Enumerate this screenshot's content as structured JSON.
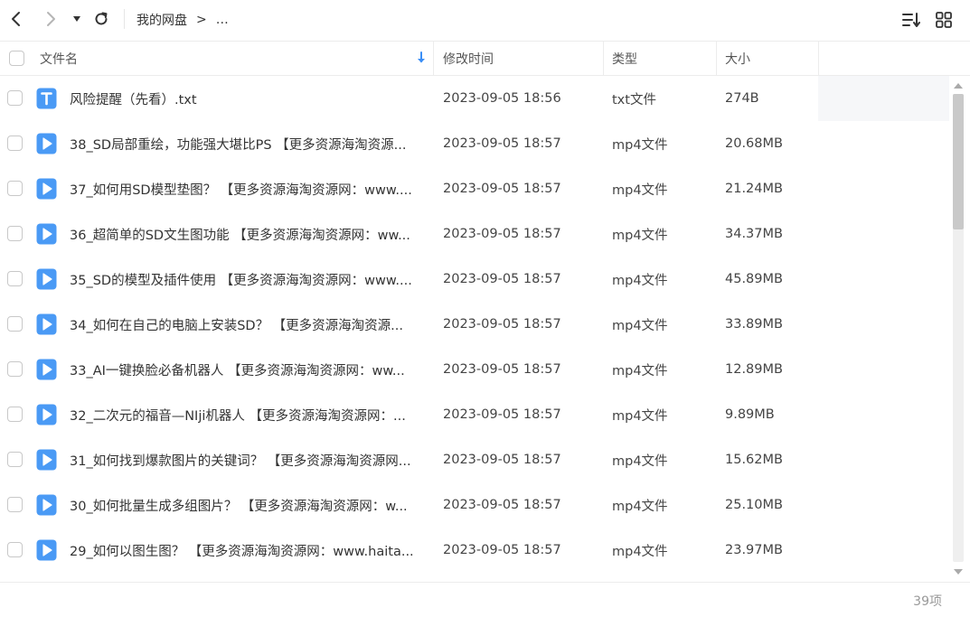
{
  "toolbar": {
    "breadcrumb": [
      "我的网盘",
      "…"
    ],
    "breadcrumb_separator": ">"
  },
  "header": {
    "name": "文件名",
    "modified": "修改时间",
    "type": "类型",
    "size": "大小"
  },
  "files": [
    {
      "name": "风险提醒（先看）.txt",
      "time": "2023-09-05 18:56",
      "type": "txt文件",
      "size": "274B",
      "icon": "txt-file-icon"
    },
    {
      "name": "38_SD局部重绘，功能强大堪比PS 【更多资源海淘资源...",
      "time": "2023-09-05 18:57",
      "type": "mp4文件",
      "size": "20.68MB",
      "icon": "video-file-icon"
    },
    {
      "name": "37_如何用SD模型垫图？ 【更多资源海淘资源网：www....",
      "time": "2023-09-05 18:57",
      "type": "mp4文件",
      "size": "21.24MB",
      "icon": "video-file-icon"
    },
    {
      "name": "36_超简单的SD文生图功能 【更多资源海淘资源网：ww...",
      "time": "2023-09-05 18:57",
      "type": "mp4文件",
      "size": "34.37MB",
      "icon": "video-file-icon"
    },
    {
      "name": "35_SD的模型及插件使用 【更多资源海淘资源网：www....",
      "time": "2023-09-05 18:57",
      "type": "mp4文件",
      "size": "45.89MB",
      "icon": "video-file-icon"
    },
    {
      "name": "34_如何在自己的电脑上安装SD？ 【更多资源海淘资源...",
      "time": "2023-09-05 18:57",
      "type": "mp4文件",
      "size": "33.89MB",
      "icon": "video-file-icon"
    },
    {
      "name": "33_AI一键换脸必备机器人 【更多资源海淘资源网：ww...",
      "time": "2023-09-05 18:57",
      "type": "mp4文件",
      "size": "12.89MB",
      "icon": "video-file-icon"
    },
    {
      "name": "32_二次元的福音—NIji机器人 【更多资源海淘资源网：...",
      "time": "2023-09-05 18:57",
      "type": "mp4文件",
      "size": "9.89MB",
      "icon": "video-file-icon"
    },
    {
      "name": "31_如何找到爆款图片的关键词？ 【更多资源海淘资源网...",
      "time": "2023-09-05 18:57",
      "type": "mp4文件",
      "size": "15.62MB",
      "icon": "video-file-icon"
    },
    {
      "name": "30_如何批量生成多组图片？ 【更多资源海淘资源网：w...",
      "time": "2023-09-05 18:57",
      "type": "mp4文件",
      "size": "25.10MB",
      "icon": "video-file-icon"
    },
    {
      "name": "29_如何以图生图？ 【更多资源海淘资源网：www.haita...",
      "time": "2023-09-05 18:57",
      "type": "mp4文件",
      "size": "23.97MB",
      "icon": "video-file-icon"
    }
  ],
  "footer": {
    "count": "39项"
  },
  "colors": {
    "accent": "#3a8ef6",
    "icon_blue": "#4a9af5"
  }
}
